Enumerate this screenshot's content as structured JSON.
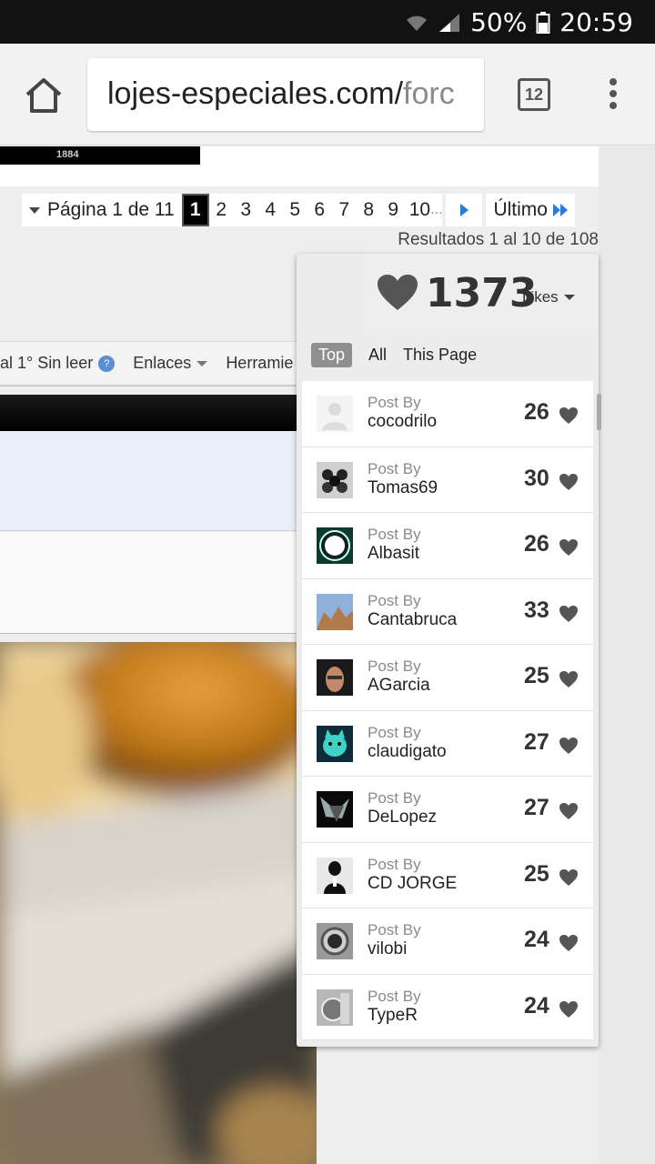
{
  "status_bar": {
    "battery": "50%",
    "time": "20:59"
  },
  "browser": {
    "url_main": "lojes-especiales.com/",
    "url_tail": "forc",
    "tab_count": "12"
  },
  "banner": {
    "year": "1884"
  },
  "pagination": {
    "label": "Página 1 de 11",
    "pages": [
      "1",
      "2",
      "3",
      "4",
      "5",
      "6",
      "7",
      "8",
      "9",
      "10"
    ],
    "current_page": "1",
    "ellipsis": "...",
    "last_label": "Último",
    "results_text": "Resultados 1 al 10 de 108"
  },
  "navbar": {
    "item1": "al 1° Sin leer",
    "item2": "Enlaces",
    "item3": "Herramie"
  },
  "likes": {
    "count": "1373",
    "label": "Likes",
    "tabs": [
      "Top",
      "All",
      "This Page"
    ],
    "active_tab": "Top",
    "post_by_label": "Post By",
    "items": [
      {
        "name": "cocodrilo",
        "likes": "26"
      },
      {
        "name": "Tomas69",
        "likes": "30"
      },
      {
        "name": "Albasit",
        "likes": "26"
      },
      {
        "name": "Cantabruca",
        "likes": "33"
      },
      {
        "name": "AGarcia",
        "likes": "25"
      },
      {
        "name": "claudigato",
        "likes": "27"
      },
      {
        "name": "DeLopez",
        "likes": "27"
      },
      {
        "name": "CD JORGE",
        "likes": "25"
      },
      {
        "name": "vilobi",
        "likes": "24"
      },
      {
        "name": "TypeR",
        "likes": "24"
      }
    ]
  }
}
